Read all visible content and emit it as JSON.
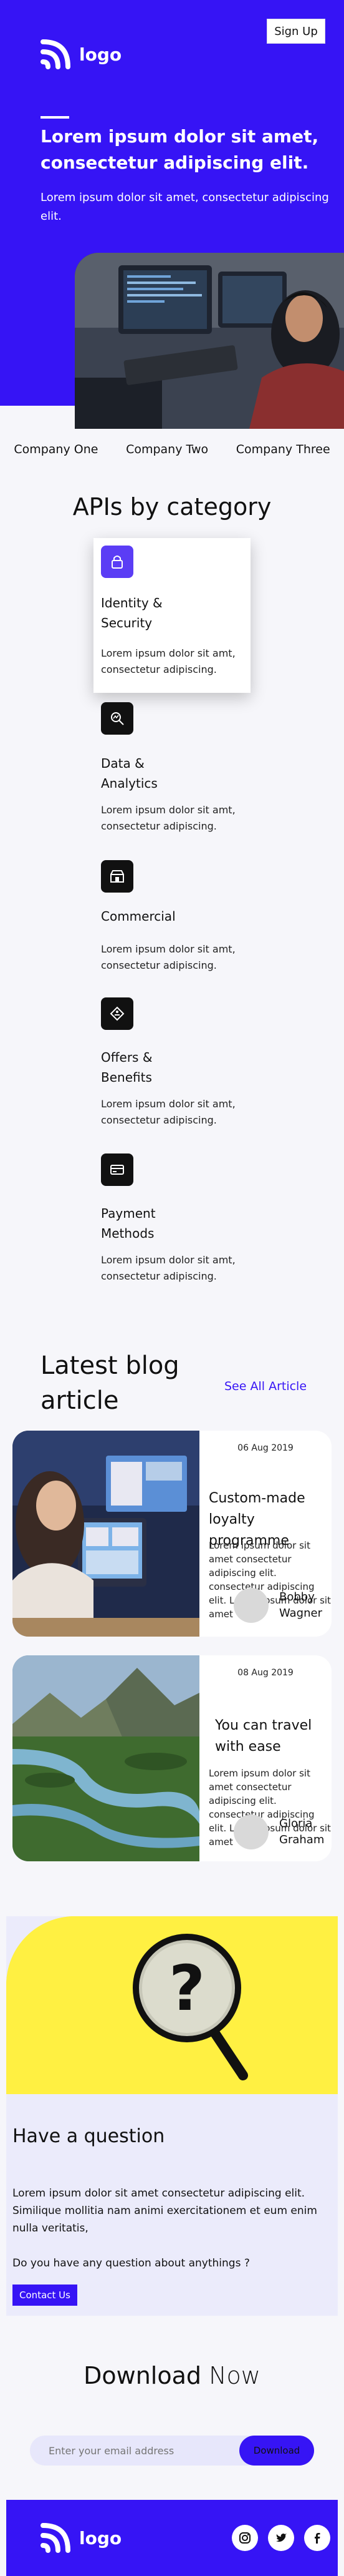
{
  "header": {
    "logo_text": "logo",
    "signup_label": "Sign Up"
  },
  "hero": {
    "title": "Lorem ipsum dolor sit amet, consectetur adipiscing elit.",
    "subtitle": "Lorem ipsum dolor sit amet, consectetur adipiscing elit."
  },
  "companies": [
    "Company One",
    "Company Two",
    "Company Three"
  ],
  "apis": {
    "heading": "APIs by category",
    "items": [
      {
        "title": "Identity &\nSecurity",
        "desc": "Lorem ipsum dolor sit amt, consectetur adipiscing.",
        "icon": "lock-icon"
      },
      {
        "title": "Data &\nAnalytics",
        "desc": "Lorem ipsum dolor sit amt, consectetur adipiscing.",
        "icon": "analytics-search-icon"
      },
      {
        "title": "Commercial",
        "desc": "Lorem ipsum dolor sit amt, consectetur adipiscing.",
        "icon": "storefront-icon"
      },
      {
        "title": "Offers &\nBenefits",
        "desc": "Lorem ipsum dolor sit amt, consectetur adipiscing.",
        "icon": "offer-badge-icon"
      },
      {
        "title": "Payment\nMethods",
        "desc": "Lorem ipsum dolor sit amt, consectetur adipiscing.",
        "icon": "credit-card-icon"
      }
    ]
  },
  "blog": {
    "heading": "Latest blog article",
    "see_all": "See All Article",
    "posts": [
      {
        "date": "06 Aug 2019",
        "title": "Custom-made loyalty programme",
        "text": "Lorem ipsum dolor sit amet consectetur adipiscing elit. consectetur adipiscing elit. Lorem ipsum dolor sit amet",
        "author": "Bobby\nWagner"
      },
      {
        "date": "08 Aug 2019",
        "title": "You can travel with ease",
        "text": "Lorem ipsum dolor sit amet consectetur adipiscing elit. consectetur adipiscing elit. Lorem ipsum dolor sit amet",
        "author": "Gloria\nGraham"
      }
    ]
  },
  "question": {
    "title": "Have a question",
    "text": "Lorem ipsum dolor sit amet consectetur adipiscing elit. Similique mollitia nam animi exercitationem et eum enim nulla veritatis,",
    "ask": "Do you have any question about anythings ?",
    "contact_label": "Contact Us"
  },
  "download": {
    "title_bold": "Download",
    "title_light": "Now",
    "placeholder": "Enter your email address",
    "button_label": "Download"
  },
  "footer": {
    "logo_text": "logo",
    "social": [
      "instagram-icon",
      "twitter-icon",
      "facebook-icon"
    ]
  }
}
